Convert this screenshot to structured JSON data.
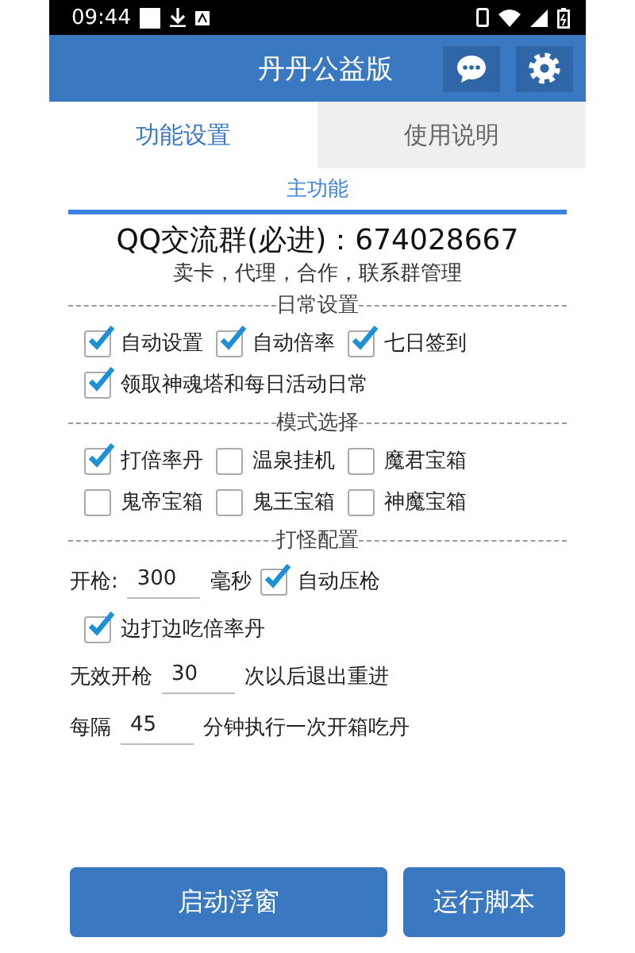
{
  "status_bar": {
    "time": "09:44"
  },
  "app_bar": {
    "title": "丹丹公益版"
  },
  "tabs": [
    {
      "label": "功能设置",
      "selected": true
    },
    {
      "label": "使用说明",
      "selected": false
    }
  ],
  "section_tab": "主功能",
  "qq_line": "QQ交流群(必进)：674028667",
  "contact_note": "卖卡，代理，合作，联系群管理",
  "sections": [
    {
      "title": "日常设置",
      "rows": [
        [
          {
            "kind": "checkbox",
            "label": "自动设置",
            "checked": true
          },
          {
            "kind": "checkbox",
            "label": "自动倍率",
            "checked": true
          },
          {
            "kind": "checkbox",
            "label": "七日签到",
            "checked": true
          }
        ],
        [
          {
            "kind": "checkbox",
            "label": "领取神魂塔和每日活动日常",
            "checked": true
          }
        ]
      ]
    },
    {
      "title": "模式选择",
      "rows": [
        [
          {
            "kind": "checkbox",
            "label": "打倍率丹",
            "checked": true
          },
          {
            "kind": "checkbox",
            "label": "温泉挂机",
            "checked": false
          },
          {
            "kind": "checkbox",
            "label": "魔君宝箱",
            "checked": false
          }
        ],
        [
          {
            "kind": "checkbox",
            "label": "鬼帝宝箱",
            "checked": false
          },
          {
            "kind": "checkbox",
            "label": "鬼王宝箱",
            "checked": false
          },
          {
            "kind": "checkbox",
            "label": "神魔宝箱",
            "checked": false
          }
        ]
      ]
    },
    {
      "title": "打怪配置",
      "rows": [
        [
          {
            "kind": "text",
            "text": "开枪:"
          },
          {
            "kind": "field",
            "value": "300"
          },
          {
            "kind": "text",
            "text": "毫秒"
          },
          {
            "kind": "checkbox",
            "label": "自动压枪",
            "checked": true
          }
        ],
        [
          {
            "kind": "checkbox",
            "label": "边打边吃倍率丹",
            "checked": true
          }
        ],
        [
          {
            "kind": "text",
            "text": "无效开枪"
          },
          {
            "kind": "field",
            "value": "30"
          },
          {
            "kind": "text",
            "text": "次以后退出重进"
          }
        ],
        [
          {
            "kind": "text",
            "text": "每隔"
          },
          {
            "kind": "field",
            "value": "45"
          },
          {
            "kind": "text",
            "text": "分钟执行一次开箱吃丹"
          }
        ]
      ]
    }
  ],
  "buttons": [
    "启动浮窗",
    "运行脚本"
  ]
}
